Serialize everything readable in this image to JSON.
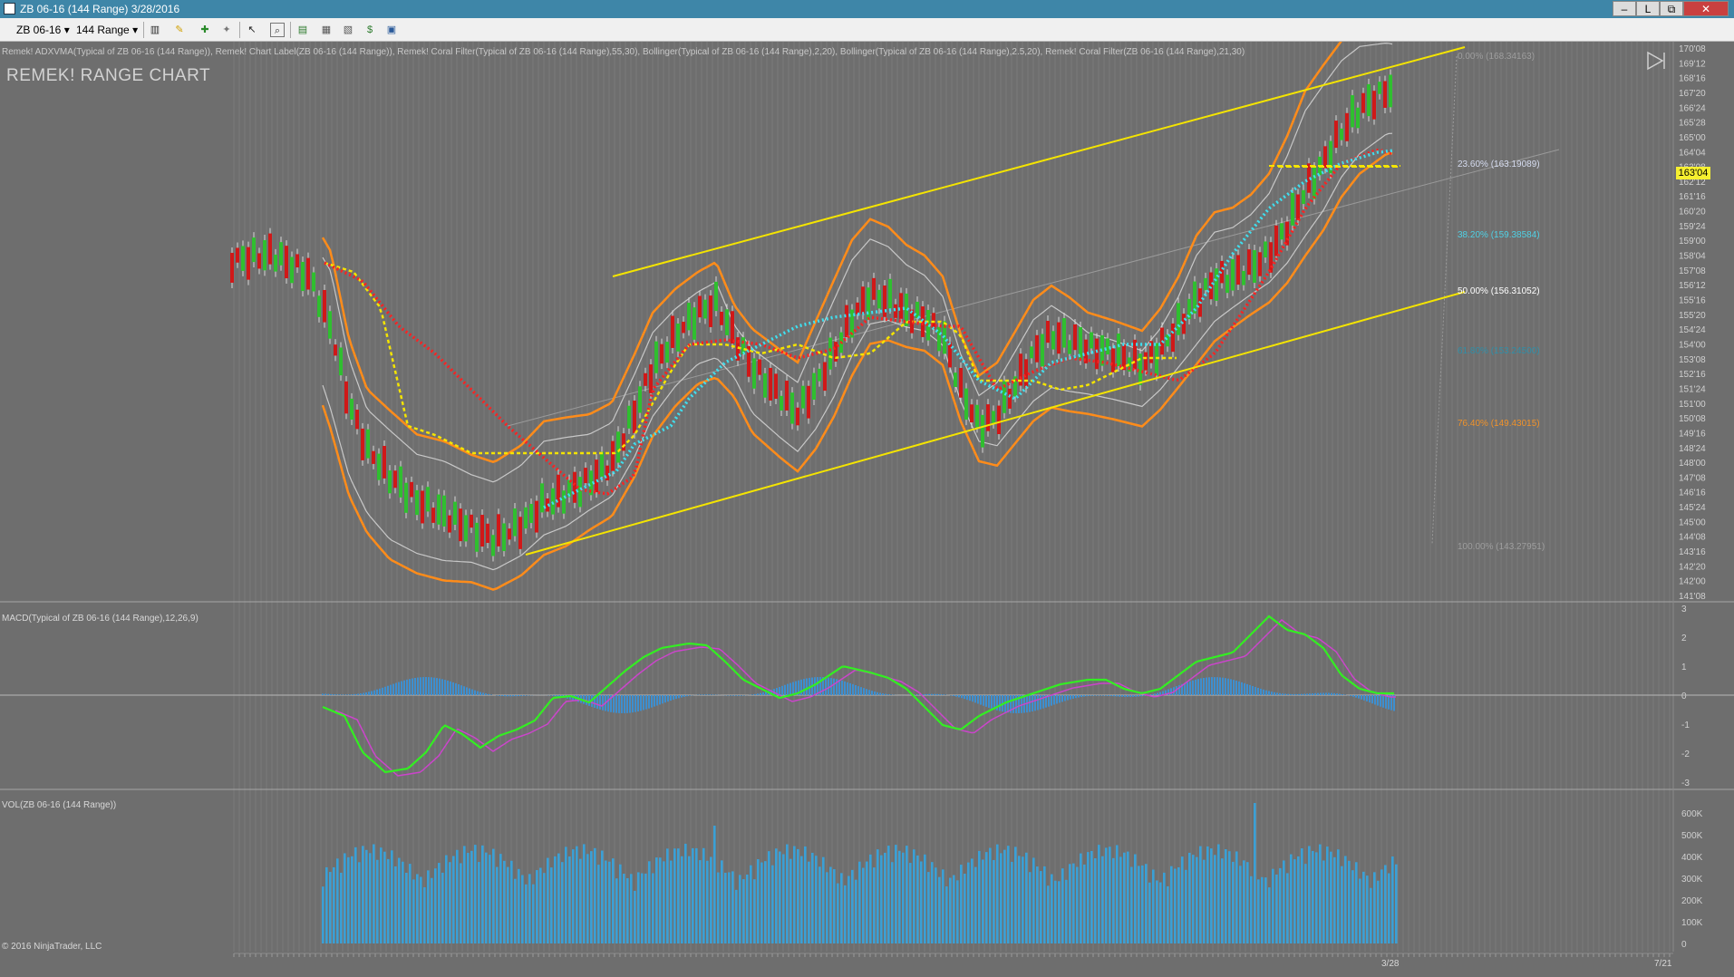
{
  "window": {
    "title": "ZB 06-16 (144 Range)  3/28/2016",
    "controls": [
      "–",
      "L",
      "⧉",
      "✕"
    ]
  },
  "toolbar": {
    "instrument": "ZB 06-16",
    "interval": "144 Range",
    "icons": [
      "bar-style-icon",
      "draw-pencil-icon",
      "drawing-tool-icon",
      "pin-icon",
      "cursor-icon",
      "zoom-icon",
      "data-box-icon",
      "properties-icon",
      "indicators-icon",
      "strategies-icon",
      "template-icon"
    ]
  },
  "chart": {
    "indicator_label": "Remek! ADXVMA(Typical of ZB 06-16 (144 Range)), Remek! Chart Label(ZB 06-16 (144 Range)), Remek! Coral Filter(Typical of ZB 06-16 (144 Range),55,30), Bollinger(Typical of ZB 06-16 (144 Range),2,20), Bollinger(Typical of ZB 06-16 (144 Range),2.5,20), Remek! Coral Filter(ZB 06-16 (144 Range),21,30)",
    "watermark": "REMEK! RANGE CHART",
    "price_axis": [
      "170'08",
      "169'12",
      "168'16",
      "167'20",
      "166'24",
      "165'28",
      "165'00",
      "164'04",
      "163'08",
      "162'12",
      "161'16",
      "160'20",
      "159'24",
      "159'00",
      "158'04",
      "157'08",
      "156'12",
      "155'16",
      "155'20",
      "154'24",
      "154'00",
      "153'08",
      "152'16",
      "151'24",
      "151'00",
      "150'08",
      "149'16",
      "148'24",
      "148'00",
      "147'08",
      "146'16",
      "145'24",
      "145'00",
      "144'08",
      "143'16",
      "142'20",
      "142'00",
      "141'08"
    ],
    "last_price": "163'04",
    "fib_levels": [
      {
        "label": "0.00% (168.34163)",
        "color": "#9e9e9e"
      },
      {
        "label": "23.60% (163.19089)",
        "color": "#d6dcf0"
      },
      {
        "label": "38.20% (159.38584)",
        "color": "#4fd0e4"
      },
      {
        "label": "50.00% (156.31052)",
        "color": "#ffffff"
      },
      {
        "label": "61.80% (153.24500)",
        "color": "#2f8fa8"
      },
      {
        "label": "76.40% (149.43015)",
        "color": "#f0922a"
      },
      {
        "label": "100.00% (143.27951)",
        "color": "#9e9e9e"
      }
    ]
  },
  "macd_panel": {
    "label": "MACD(Typical of ZB 06-16 (144 Range),12,26,9)",
    "axis": [
      "3",
      "2",
      "1",
      "0",
      "-1",
      "-2",
      "-3"
    ]
  },
  "vol_panel": {
    "label": "VOL(ZB 06-16 (144 Range))",
    "axis": [
      "600K",
      "500K",
      "400K",
      "300K",
      "200K",
      "100K",
      "0"
    ]
  },
  "time_axis": [
    "3/28",
    "7/21"
  ],
  "copyright": "© 2016 NinjaTrader, LLC",
  "colors": {
    "channel": "#f4e400",
    "bollinger_outer": "#ff8c1a",
    "bollinger_inner": "#c8c8c8",
    "coral_fast": "#3fe0f0",
    "adxvma": "#ff2020",
    "coral_slow": "#f4e400",
    "macd": "#33ee22",
    "macd_signal": "#cc44cc",
    "histogram": "#3d8fd0",
    "volume": "#3aa0d6"
  }
}
